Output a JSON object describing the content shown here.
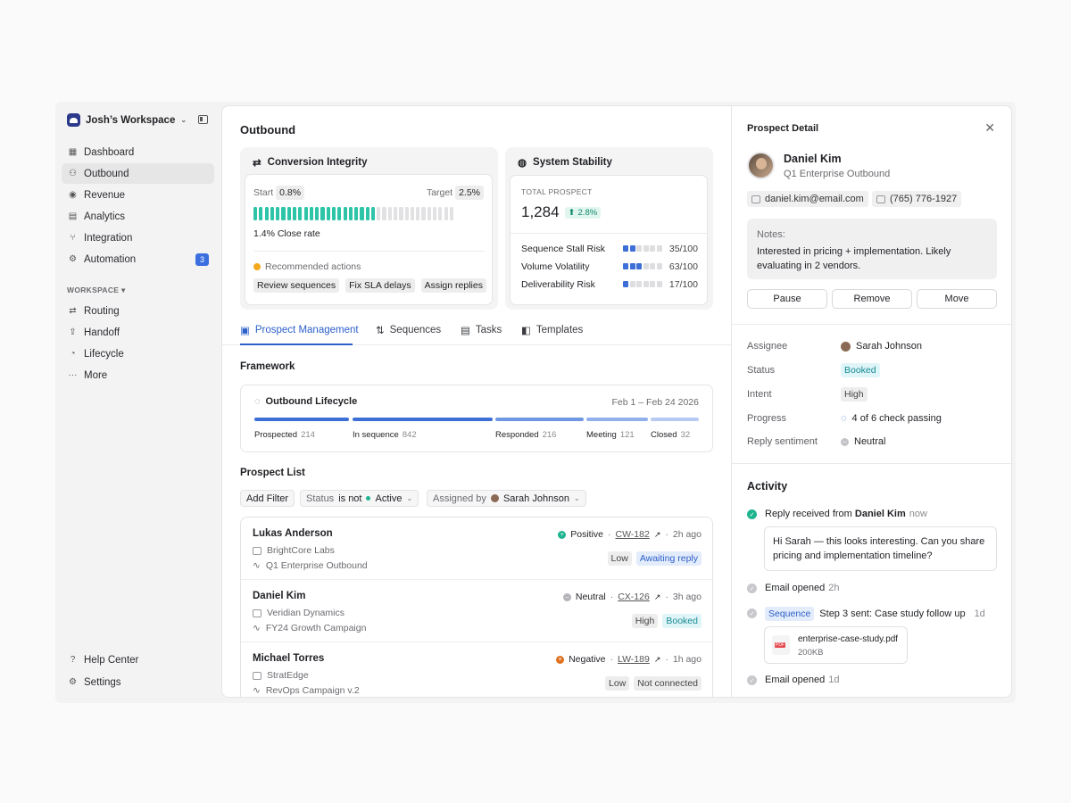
{
  "workspace": {
    "name": "Josh’s Workspace"
  },
  "nav": {
    "items": [
      {
        "label": "Dashboard"
      },
      {
        "label": "Outbound"
      },
      {
        "label": "Revenue"
      },
      {
        "label": "Analytics"
      },
      {
        "label": "Integration"
      },
      {
        "label": "Automation",
        "badge": "3"
      }
    ],
    "section_label": "WORKSPACE",
    "workspace_items": [
      {
        "label": "Routing"
      },
      {
        "label": "Handoff"
      },
      {
        "label": "Lifecycle"
      },
      {
        "label": "More"
      }
    ],
    "footer": [
      {
        "label": "Help Center"
      },
      {
        "label": "Settings"
      }
    ]
  },
  "main": {
    "title": "Outbound",
    "conversion": {
      "title": "Conversion Integrity",
      "start_label": "Start",
      "start_value": "0.8%",
      "target_label": "Target",
      "target_value": "2.5%",
      "progress_filled": 22,
      "progress_total": 36,
      "close_rate": "1.4% Close rate",
      "recommended": "Recommended actions",
      "actions": [
        "Review sequences",
        "Fix SLA delays",
        "Assign replies"
      ]
    },
    "stability": {
      "title": "System Stability",
      "total_label": "TOTAL PROSPECT",
      "total_value": "1,284",
      "delta": "2.8%",
      "risks": [
        {
          "label": "Sequence Stall Risk",
          "value": "35/100",
          "filled": 2
        },
        {
          "label": "Volume Volatility",
          "value": "63/100",
          "filled": 3
        },
        {
          "label": "Deliverability Risk",
          "value": "17/100",
          "filled": 1
        }
      ]
    },
    "tabs": [
      "Prospect Management",
      "Sequences",
      "Tasks",
      "Templates"
    ],
    "framework_title": "Framework",
    "lifecycle": {
      "title": "Outbound Lifecycle",
      "dates": "Feb 1 – Feb 24 2026",
      "stages": [
        {
          "label": "Prospected",
          "count": "214",
          "color": "#3d6fd6"
        },
        {
          "label": "In sequence",
          "count": "842",
          "color": "#3d6fd6"
        },
        {
          "label": "Responded",
          "count": "216",
          "color": "#6f97e3"
        },
        {
          "label": "Meeting",
          "count": "121",
          "color": "#92b1ec"
        },
        {
          "label": "Closed",
          "count": "32",
          "color": "#b6caf2"
        }
      ]
    },
    "prospect_list_title": "Prospect List",
    "filters": {
      "add": "Add Filter",
      "status_key": "Status",
      "status_op": "is not",
      "status_value": "Active",
      "assigned_key": "Assigned by",
      "assigned_value": "Sarah Johnson"
    },
    "prospects": [
      {
        "name": "Lukas Anderson",
        "company": "BrightCore Labs",
        "campaign": "Q1 Enterprise Outbound",
        "sentiment": "Positive",
        "sentiment_color": "#1fb48f",
        "ticket": "CW-182",
        "time": "2h ago",
        "tags": [
          {
            "t": "Low",
            "c": ""
          },
          {
            "t": "Awaiting reply",
            "c": "blue"
          }
        ]
      },
      {
        "name": "Daniel Kim",
        "company": "Veridian Dynamics",
        "campaign": "FY24 Growth Campaign",
        "sentiment": "Neutral",
        "sentiment_color": "#a9a9ae",
        "ticket": "CX-126",
        "time": "3h ago",
        "tags": [
          {
            "t": "High",
            "c": ""
          },
          {
            "t": "Booked",
            "c": "cyan"
          }
        ]
      },
      {
        "name": "Michael Torres",
        "company": "StratEdge",
        "campaign": "RevOps Campaign v.2",
        "sentiment": "Negative",
        "sentiment_color": "#e0701f",
        "ticket": "LW-189",
        "time": "1h ago",
        "tags": [
          {
            "t": "Low",
            "c": ""
          },
          {
            "t": "Not connected",
            "c": ""
          }
        ]
      }
    ]
  },
  "detail": {
    "title": "Prospect Detail",
    "name": "Daniel Kim",
    "campaign": "Q1 Enterprise Outbound",
    "email": "daniel.kim@email.com",
    "phone": "(765) 776-1927",
    "notes_label": "Notes:",
    "notes": "Interested in pricing + implementation. Likely evaluating in 2 vendors.",
    "buttons": [
      "Pause",
      "Remove",
      "Move"
    ],
    "props": {
      "assignee_label": "Assignee",
      "assignee": "Sarah Johnson",
      "status_label": "Status",
      "status": "Booked",
      "intent_label": "Intent",
      "intent": "High",
      "progress_label": "Progress",
      "progress": "4 of 6 check passing",
      "sentiment_label": "Reply sentiment",
      "sentiment": "Neutral"
    },
    "activity_title": "Activity",
    "activity": {
      "reply_prefix": "Reply received from",
      "reply_from": "Daniel Kim",
      "reply_time": "now",
      "reply_body": "Hi Sarah — this looks interesting. Can you share pricing and implementation timeline?",
      "opened1": "Email opened",
      "opened1_time": "2h",
      "seq_tag": "Sequence",
      "seq_text": "Step 3 sent: Case study follow up",
      "seq_time": "1d",
      "file_name": "enterprise-case-study.pdf",
      "file_size": "200KB",
      "opened2": "Email opened",
      "opened2_time": "1d"
    }
  }
}
